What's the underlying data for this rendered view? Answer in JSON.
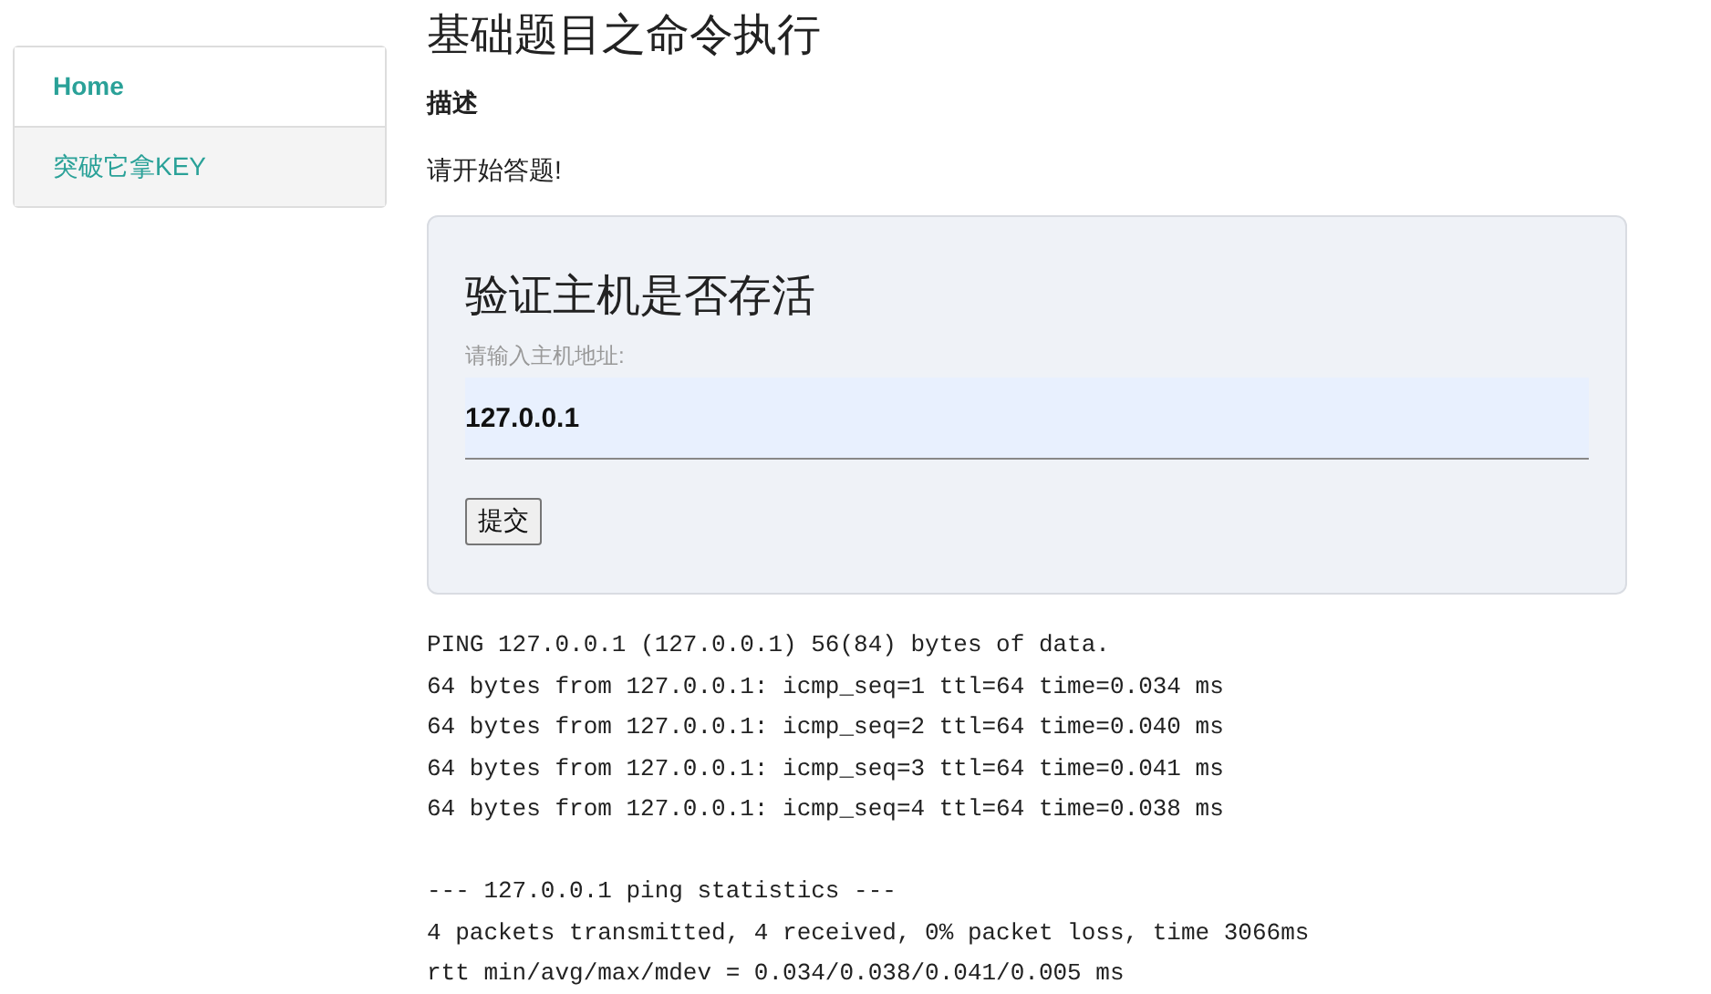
{
  "sidebar": {
    "items": [
      {
        "label": "Home",
        "selected": false
      },
      {
        "label": "突破它拿KEY",
        "selected": true
      }
    ]
  },
  "page": {
    "title": "基础题目之命令执行",
    "description_heading": "描述",
    "prompt": "请开始答题!"
  },
  "form": {
    "title": "验证主机是否存活",
    "field_label": "请输入主机地址:",
    "field_value": "127.0.0.1",
    "submit": "提交"
  },
  "output": {
    "reply_lines": [
      "PING 127.0.0.1 (127.0.0.1) 56(84) bytes of data.",
      "64 bytes from 127.0.0.1: icmp_seq=1 ttl=64 time=0.034 ms",
      "64 bytes from 127.0.0.1: icmp_seq=2 ttl=64 time=0.040 ms",
      "64 bytes from 127.0.0.1: icmp_seq=3 ttl=64 time=0.041 ms",
      "64 bytes from 127.0.0.1: icmp_seq=4 ttl=64 time=0.038 ms"
    ],
    "statistics_lines": [
      "--- 127.0.0.1 ping statistics ---",
      "4 packets transmitted, 4 received, 0% packet loss, time 3066ms",
      "rtt min/avg/max/mdev = 0.034/0.038/0.041/0.005 ms"
    ]
  }
}
